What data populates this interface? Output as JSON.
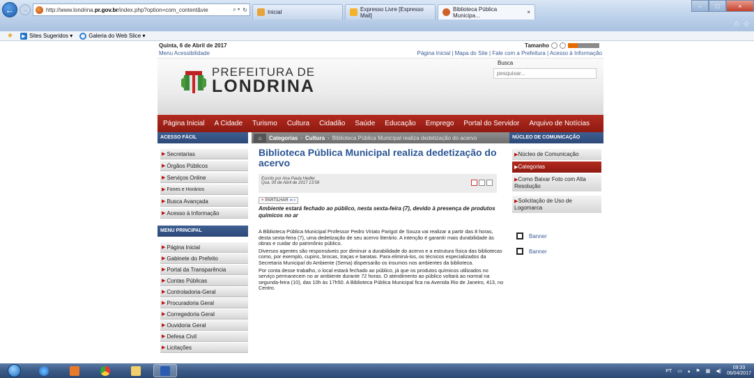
{
  "browser": {
    "url_prefix": "http://www.londrina.",
    "url_domain": "pr.gov.br",
    "url_suffix": "/index.php?option=com_content&vie",
    "tabs": [
      {
        "label": "Inicial"
      },
      {
        "label": "Expresso Livre [Expresso Mail]"
      },
      {
        "label": "Biblioteca Pública Municipa...",
        "close": "×"
      }
    ],
    "favorites": [
      {
        "label": "Sites Sugeridos ▾"
      },
      {
        "label": "Galeria do Web Slice ▾"
      }
    ]
  },
  "site": {
    "date": "Quinta, 6 de Abril de 2017",
    "accessibility_menu": "Menu Acessibilidade",
    "tamanho": "Tamanho",
    "top_links": "Página Inicial | Mapa do Site | Fale com a Prefeitura | Acesso à Informação",
    "busca_label": "Busca",
    "busca_placeholder": "pesquisar...",
    "logo_line1": "PREFEITURA DE",
    "logo_line2": "LONDRINA",
    "menu": [
      "Página Inicial",
      "A Cidade",
      "Turismo",
      "Cultura",
      "Cidadão",
      "Saúde",
      "Educação",
      "Emprego",
      "Portal do Servidor",
      "Arquivo de Notícias"
    ]
  },
  "left": {
    "acesso_title": "ACESSO FÁCIL",
    "acesso_items": [
      "Secretarias",
      "Órgãos Públicos",
      "Serviços Online",
      "Fones e Horários",
      "Busca Avançada",
      "Acesso à Informação"
    ],
    "menu_title": "MENU PRINCIPAL",
    "menu_items": [
      "Página Inicial",
      "Gabinete do Prefeito",
      "Portal da Transparência",
      "Contas Públicas",
      "Controladoria-Geral",
      "Procuradoria Geral",
      "Corregedoria Geral",
      "Ouvidoria Geral",
      "Defesa Civil",
      "Licitações"
    ]
  },
  "article": {
    "crumb_1": "Categorias",
    "crumb_2": "Cultura",
    "crumb_3": "Biblioteca Pública Municipal realiza dedetização do acervo",
    "title": "Biblioteca Pública Municipal realiza dedetização do acervo",
    "author": "Escrito por Ana Paula Hedler",
    "datetime": "Qua, 05 de Abril de 2017 13:58",
    "share_label": "PARTILHAR",
    "lead": "Ambiente estará fechado ao público, nesta sexta-feira (7), devido à presença de produtos químicos no ar",
    "paragraphs": [
      "A Biblioteca Pública Municipal Professor Pedro Viriato Parigot de Souza vai realizar a partir das 8 horas, desta sexta-feira (7), uma dedetização de seu acervo literário. A intenção é garantir mais durabilidade às obras e cuidar do patrimônio público.",
      "Diversos agentes são responsáveis por diminuir a durabilidade do acervo e a estrutura física das bibliotecas como, por exemplo, cupins, brocas, traças e baratas. Para eliminá-los, os técnicos especializados da Secretaria Municipal do Ambiente (Sema) dispersarão os insumos nos ambientes da biblioteca.",
      "Por conta desse trabalho, o local estará fechado ao público, já que os produtos químicos utilizados no serviço permanecem no ar ambiente durante 72 horas. O atendimento ao público voltará ao normal na segunda-feira (10), das 10h às 17h50. A Biblioteca Pública Municipal fica na Avenida Rio de Janeiro, 413, no Centro."
    ]
  },
  "right": {
    "title": "NÚCLEO DE COMUNICAÇÃO",
    "items": [
      "Núcleo de Comunicação",
      "Categorias",
      "Como Baixar Foto com Alta Resolução",
      "Solicitação de Uso de Logomarca"
    ],
    "banners": [
      "Banner",
      "Banner"
    ]
  },
  "taskbar": {
    "lang": "PT",
    "time": "09:33",
    "date": "06/04/2017"
  },
  "colors": {
    "menu_red": "#a1241a",
    "section_blue": "#34548a",
    "title_blue": "#2a5594"
  }
}
